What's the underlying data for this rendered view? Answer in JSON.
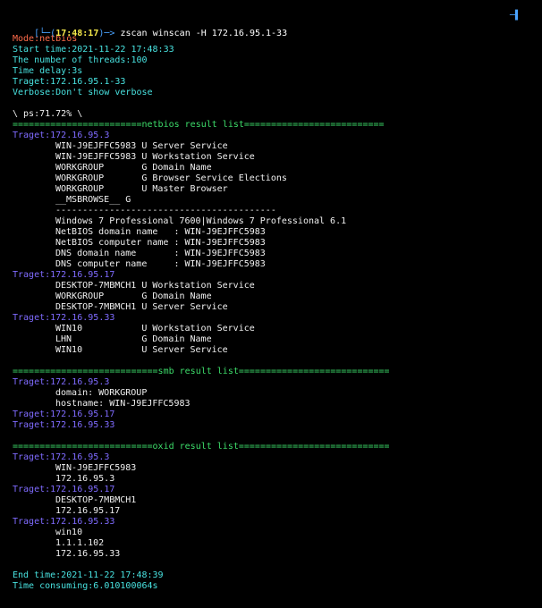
{
  "prompt": {
    "corner": "[└─(",
    "time": "17:48:17",
    "arrow": ")─> ",
    "command": "zscan winscan -H 172.16.95.1-33",
    "right_mark": "─▌"
  },
  "config": {
    "mode": "Mode:netbios",
    "start_time": "Start time:2021-11-22 17:48:33",
    "threads": "The number of threads:100",
    "delay": "Time delay:3s",
    "target": "Traget:172.16.95.1-33",
    "verbose": "Verbose:Don't show verbose"
  },
  "progress": "\\ ps:71.72% \\",
  "netbios": {
    "header": "========================netbios result list==========================",
    "hosts": [
      {
        "target": "Traget:172.16.95.3",
        "lines": [
          "WIN-J9EJFFC5983 U Server Service",
          "WIN-J9EJFFC5983 U Workstation Service",
          "WORKGROUP       G Domain Name",
          "WORKGROUP       G Browser Service Elections",
          "WORKGROUP       U Master Browser",
          "__MSBROWSE__ G",
          "-----------------------------------------",
          "Windows 7 Professional 7600|Windows 7 Professional 6.1",
          "NetBIOS domain name   : WIN-J9EJFFC5983",
          "NetBIOS computer name : WIN-J9EJFFC5983",
          "DNS domain name       : WIN-J9EJFFC5983",
          "DNS computer name     : WIN-J9EJFFC5983"
        ]
      },
      {
        "target": "Traget:172.16.95.17",
        "lines": [
          "DESKTOP-7MBMCH1 U Workstation Service",
          "WORKGROUP       G Domain Name",
          "DESKTOP-7MBMCH1 U Server Service"
        ]
      },
      {
        "target": "Traget:172.16.95.33",
        "lines": [
          "WIN10           U Workstation Service",
          "LHN             G Domain Name",
          "WIN10           U Server Service"
        ]
      }
    ]
  },
  "smb": {
    "header": "===========================smb result list============================",
    "hosts": [
      {
        "target": "Traget:172.16.95.3",
        "lines": [
          "domain: WORKGROUP",
          "hostname: WIN-J9EJFFC5983"
        ]
      },
      {
        "target": "Traget:172.16.95.17",
        "lines": []
      },
      {
        "target": "Traget:172.16.95.33",
        "lines": []
      }
    ]
  },
  "oxid": {
    "header": "==========================oxid result list============================",
    "hosts": [
      {
        "target": "Traget:172.16.95.3",
        "lines": [
          "WIN-J9EJFFC5983",
          "172.16.95.3"
        ]
      },
      {
        "target": "Traget:172.16.95.17",
        "lines": [
          "DESKTOP-7MBMCH1",
          "172.16.95.17"
        ]
      },
      {
        "target": "Traget:172.16.95.33",
        "lines": [
          "win10",
          "1.1.1.102",
          "172.16.95.33"
        ]
      }
    ]
  },
  "footer": {
    "end_time": "End time:2021-11-22 17:48:39",
    "consuming": "Time consuming:6.010100064s"
  },
  "colors": {
    "background": "#000000",
    "orange": "#ff6b4a",
    "cyan": "#48e2e0",
    "green": "#3ddc6a",
    "purple": "#7f6bff",
    "prompt_blue": "#4aa3ff",
    "prompt_yellow": "#f5e94a"
  }
}
